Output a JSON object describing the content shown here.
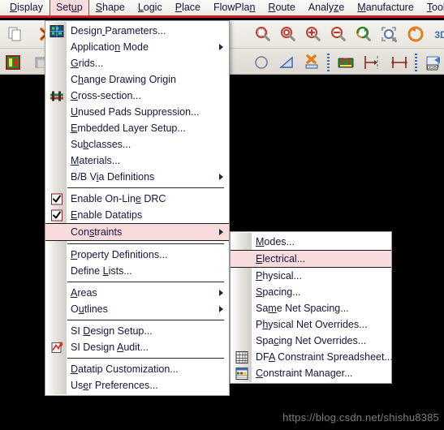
{
  "menubar": {
    "items": [
      {
        "label": "Display",
        "mnemonic_index": 0,
        "active": false
      },
      {
        "label": "Setup",
        "mnemonic_index": 3,
        "active": true
      },
      {
        "label": "Shape",
        "mnemonic_index": 0,
        "active": false
      },
      {
        "label": "Logic",
        "mnemonic_index": 0,
        "active": false
      },
      {
        "label": "Place",
        "mnemonic_index": 0,
        "active": false
      },
      {
        "label": "FlowPlan",
        "mnemonic_index": 7,
        "active": false
      },
      {
        "label": "Route",
        "mnemonic_index": 0,
        "active": false
      },
      {
        "label": "Analyze",
        "mnemonic_index": 5,
        "active": false
      },
      {
        "label": "Manufacture",
        "mnemonic_index": 0,
        "active": false
      },
      {
        "label": "Tools",
        "mnemonic_index": 0,
        "active": false
      }
    ]
  },
  "toolbar": {
    "row1": [
      {
        "name": "copy-icon",
        "kind": "copy"
      },
      {
        "name": "delete-icon",
        "kind": "delete-x"
      },
      {
        "name": "zoom-fit-icon",
        "kind": "zoom-fit"
      },
      {
        "name": "zoom-by-points-icon",
        "kind": "zoom-points"
      },
      {
        "name": "zoom-in-icon",
        "kind": "zoom-in"
      },
      {
        "name": "zoom-out-icon",
        "kind": "zoom-out"
      },
      {
        "name": "zoom-previous-icon",
        "kind": "zoom-prev"
      },
      {
        "name": "zoom-selection-icon",
        "kind": "zoom-sel"
      },
      {
        "name": "redraw-icon",
        "kind": "redraw"
      },
      {
        "name": "three-d-view-icon",
        "kind": "3d"
      },
      {
        "name": "flow-plan-icon",
        "kind": "flowplan"
      }
    ],
    "row2": [
      {
        "name": "color-layers-icon",
        "kind": "colorlayers"
      },
      {
        "name": "shape-fill-icon",
        "kind": "shapefill"
      },
      {
        "name": "shape-outline-icon",
        "kind": "shapecircle"
      },
      {
        "name": "shape-polygon-icon",
        "kind": "shapepoly"
      },
      {
        "name": "delete-shape-icon",
        "kind": "shapedelete"
      },
      {
        "name": "constraint-area-icon",
        "kind": "constraint"
      },
      {
        "name": "dimension-edge-icon",
        "kind": "dim-edge"
      },
      {
        "name": "dimension-span-icon",
        "kind": "dim-span"
      },
      {
        "name": "odb-export-icon",
        "kind": "odb"
      },
      {
        "name": "drill-legend-icon",
        "kind": "drill"
      }
    ]
  },
  "setup_menu": {
    "name": "Setup",
    "items": [
      {
        "type": "item",
        "label": "Design Parameters...",
        "mnemonic_index": 6,
        "icon": "design-parameters-icon",
        "submenu": false
      },
      {
        "type": "item",
        "label": "Application Mode",
        "mnemonic_index": 10,
        "icon": null,
        "submenu": true
      },
      {
        "type": "item",
        "label": "Grids...",
        "mnemonic_index": 0,
        "icon": null,
        "submenu": false
      },
      {
        "type": "item",
        "label": "Change Drawing Origin",
        "mnemonic_index": 1,
        "icon": null,
        "submenu": false
      },
      {
        "type": "item",
        "label": "Cross-section...",
        "mnemonic_index": 0,
        "icon": "cross-section-icon",
        "submenu": false
      },
      {
        "type": "item",
        "label": "Unused Pads Suppression...",
        "mnemonic_index": 0,
        "icon": null,
        "submenu": false
      },
      {
        "type": "item",
        "label": "Embedded Layer Setup...",
        "mnemonic_index": 0,
        "icon": null,
        "submenu": false
      },
      {
        "type": "item",
        "label": "Subclasses...",
        "mnemonic_index": 2,
        "icon": null,
        "submenu": false
      },
      {
        "type": "item",
        "label": "Materials...",
        "mnemonic_index": 0,
        "icon": null,
        "submenu": false
      },
      {
        "type": "item",
        "label": "B/B Via Definitions",
        "mnemonic_index": 5,
        "icon": null,
        "submenu": true
      },
      {
        "type": "separator"
      },
      {
        "type": "check",
        "label": "Enable On-Line DRC",
        "mnemonic_index": 13,
        "checked": true
      },
      {
        "type": "check",
        "label": "Enable Datatips",
        "mnemonic_index": 0,
        "checked": true
      },
      {
        "type": "item",
        "label": "Constraints",
        "mnemonic_index": 3,
        "icon": null,
        "submenu": true,
        "highlighted": true
      },
      {
        "type": "separator"
      },
      {
        "type": "item",
        "label": "Property Definitions...",
        "mnemonic_index": 0,
        "icon": null,
        "submenu": false
      },
      {
        "type": "item",
        "label": "Define Lists...",
        "mnemonic_index": 7,
        "icon": null,
        "submenu": false
      },
      {
        "type": "separator"
      },
      {
        "type": "item",
        "label": "Areas",
        "mnemonic_index": 0,
        "icon": null,
        "submenu": true
      },
      {
        "type": "item",
        "label": "Outlines",
        "mnemonic_index": 1,
        "icon": null,
        "submenu": true
      },
      {
        "type": "separator"
      },
      {
        "type": "item",
        "label": "SI Design Setup...",
        "mnemonic_index": 3,
        "icon": null,
        "submenu": false
      },
      {
        "type": "item",
        "label": "SI Design Audit...",
        "mnemonic_index": 10,
        "icon": "si-design-audit-icon",
        "submenu": false
      },
      {
        "type": "separator"
      },
      {
        "type": "item",
        "label": "Datatip Customization...",
        "mnemonic_index": 0,
        "icon": null,
        "submenu": false
      },
      {
        "type": "item",
        "label": "User Preferences...",
        "mnemonic_index": 2,
        "icon": null,
        "submenu": false
      }
    ]
  },
  "constraints_submenu": {
    "name": "Constraints",
    "items": [
      {
        "type": "item",
        "label": "Modes...",
        "mnemonic_index": 0,
        "icon": null,
        "highlighted": false
      },
      {
        "type": "item",
        "label": "Electrical...",
        "mnemonic_index": 0,
        "icon": null,
        "highlighted": true
      },
      {
        "type": "item",
        "label": "Physical...",
        "mnemonic_index": 0,
        "icon": null,
        "highlighted": false
      },
      {
        "type": "item",
        "label": "Spacing...",
        "mnemonic_index": 0,
        "icon": null,
        "highlighted": false
      },
      {
        "type": "item",
        "label": "Same Net Spacing...",
        "mnemonic_index": 2,
        "icon": null,
        "highlighted": false
      },
      {
        "type": "item",
        "label": "Physical Net Overrides...",
        "mnemonic_index": 1,
        "icon": null,
        "highlighted": false
      },
      {
        "type": "item",
        "label": "Spacing Net Overrides...",
        "mnemonic_index": 3,
        "icon": null,
        "highlighted": false
      },
      {
        "type": "item",
        "label": "DFA Constraint Spreadsheet...",
        "mnemonic_index": 2,
        "icon": "dfa-spreadsheet-icon",
        "highlighted": false
      },
      {
        "type": "item",
        "label": "Constraint Manager...",
        "mnemonic_index": 0,
        "icon": "constraint-manager-icon",
        "highlighted": false
      }
    ]
  },
  "watermark": {
    "text": "https://blog.csdn.net/shishu8385"
  },
  "colors": {
    "menubar_underline": "#d51a1a",
    "highlight_bg": "#f8dcdc",
    "highlight_border": "#c22c2c",
    "canvas": "#000000",
    "menu_bg": "#ffffff",
    "text": "#16163a"
  }
}
